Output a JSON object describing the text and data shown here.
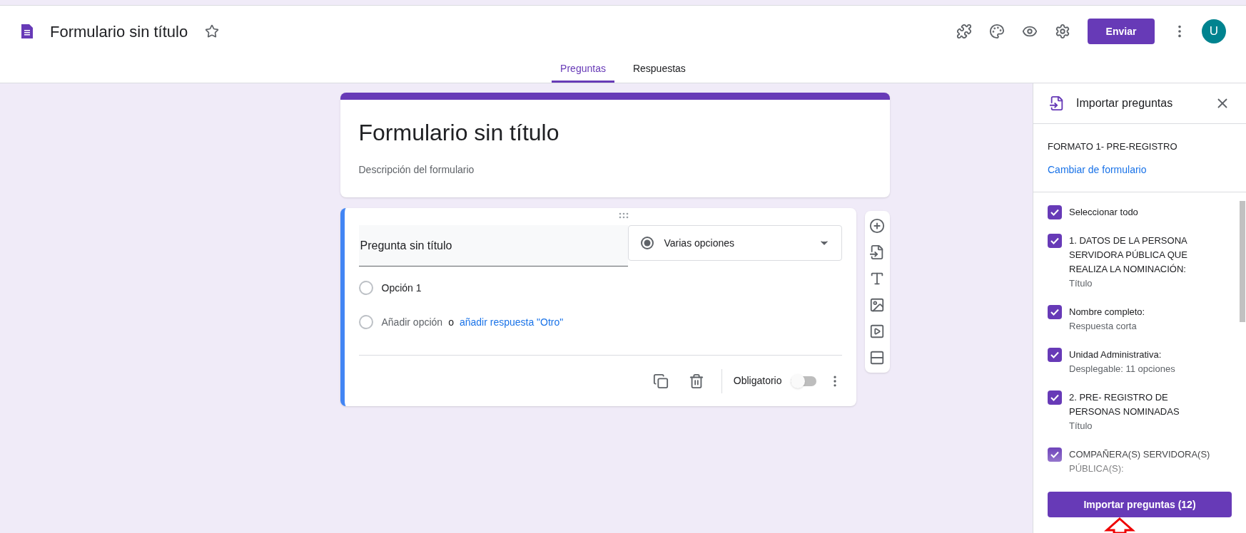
{
  "header": {
    "title": "Formulario sin título",
    "send_button": "Enviar",
    "avatar": "U"
  },
  "tabs": [
    {
      "label": "Preguntas",
      "selected": true
    },
    {
      "label": "Respuestas",
      "selected": false
    }
  ],
  "form": {
    "title": "Formulario sin título",
    "description": "Descripción del formulario"
  },
  "question": {
    "title": "Pregunta sin título",
    "type": "Varias opciones",
    "options": [
      {
        "label": "Opción 1",
        "selected": false
      }
    ],
    "add_option": "Añadir opción",
    "add_option_selected": false,
    "or": "o",
    "add_other": "añadir respuesta \"Otro\"",
    "required_label": "Obligatorio",
    "required": false
  },
  "import_panel": {
    "title": "Importar preguntas",
    "form_name": "FORMATO 1- PRE-REGISTRO",
    "change_link": "Cambiar de formulario",
    "items": [
      {
        "label": "Seleccionar todo",
        "checked": true
      },
      {
        "label": "1. DATOS DE LA PERSONA SERVIDORA PÚBLICA QUE REALIZA LA NOMINACIÓN:",
        "sublabel": "Título",
        "checked": true
      },
      {
        "label": "Nombre completo:",
        "sublabel": "Respuesta corta",
        "checked": true
      },
      {
        "label": "Unidad Administrativa:",
        "sublabel": "Desplegable: 11 opciones",
        "checked": true
      },
      {
        "label": "2. PRE- REGISTRO DE PERSONAS NOMINADAS",
        "sublabel": "Título",
        "checked": true
      },
      {
        "label": "COMPAÑERA(S) SERVIDORA(S) PÚBLICA(S):",
        "checked": true
      }
    ],
    "import_button": "Importar preguntas (12)"
  }
}
